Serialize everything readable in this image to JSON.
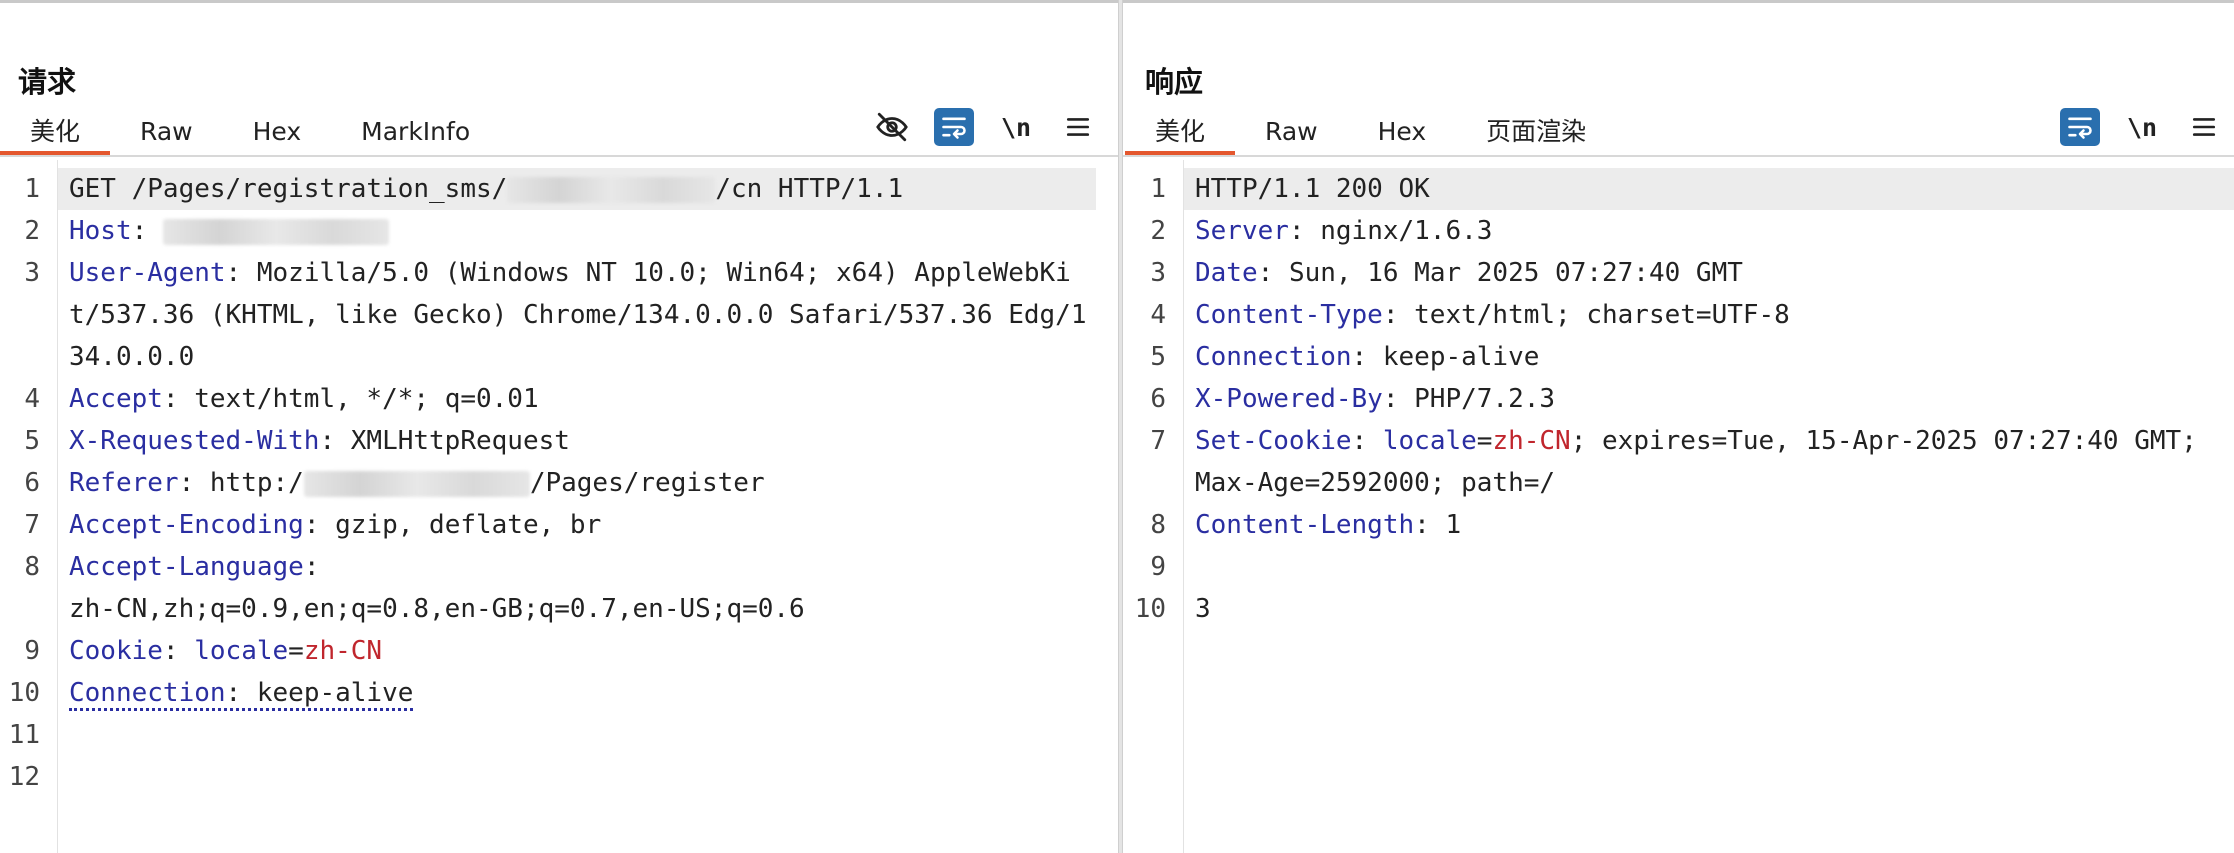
{
  "layout_switch": {
    "options": [
      {
        "icon": "split-horizontal-icon",
        "active": true
      },
      {
        "icon": "split-vertical-icon",
        "active": false
      },
      {
        "icon": "single-pane-icon",
        "active": false
      }
    ]
  },
  "request": {
    "title": "请求",
    "tabs": [
      {
        "label": "美化",
        "active": true
      },
      {
        "label": "Raw",
        "active": false
      },
      {
        "label": "Hex",
        "active": false
      },
      {
        "label": "MarkInfo",
        "active": false
      }
    ],
    "toolbar": {
      "hide_icon": "eye-off-icon",
      "wrap_icon": "wrap-lines-icon",
      "newline_label": "\\n",
      "menu_icon": "menu-icon"
    },
    "lines": {
      "l1_a": "GET /Pages/registration_sms/",
      "l1_b": "/cn HTTP/1.1",
      "l2_key": "Host",
      "l3_key": "User-Agent",
      "l3_val": "Mozilla/5.0 (Windows NT 10.0; Win64; x64) AppleWebKit/537.36 (KHTML, like Gecko) Chrome/134.0.0.0 Safari/537.36 Edg/134.0.0.0",
      "l4_key": "Accept",
      "l4_val": "text/html, */*; q=0.01",
      "l5_key": "X-Requested-With",
      "l5_val": "XMLHttpRequest",
      "l6_key": "Referer",
      "l6_val_a": "http:/",
      "l6_val_b": "/Pages/register",
      "l7_key": "Accept-Encoding",
      "l7_val": "gzip, deflate, br",
      "l8_key": "Accept-Language",
      "l8_val": "zh-CN,zh;q=0.9,en;q=0.8,en-GB;q=0.7,en-US;q=0.6",
      "l9_key": "Cookie",
      "l9_ckey": "locale",
      "l9_cval": "zh-CN",
      "l10_key": "Connection",
      "l10_val": "keep-alive"
    },
    "line_numbers": [
      "1",
      "2",
      "3",
      "4",
      "5",
      "6",
      "7",
      "8",
      "9",
      "10",
      "11",
      "12"
    ]
  },
  "response": {
    "title": "响应",
    "tabs": [
      {
        "label": "美化",
        "active": true
      },
      {
        "label": "Raw",
        "active": false
      },
      {
        "label": "Hex",
        "active": false
      },
      {
        "label": "页面渲染",
        "active": false
      }
    ],
    "toolbar": {
      "wrap_icon": "wrap-lines-icon",
      "newline_label": "\\n",
      "menu_icon": "menu-icon"
    },
    "lines": {
      "l1": "HTTP/1.1 200 OK",
      "l2_key": "Server",
      "l2_val": "nginx/1.6.3",
      "l3_key": "Date",
      "l3_val": "Sun, 16 Mar 2025 07:27:40 GMT",
      "l4_key": "Content-Type",
      "l4_val": "text/html; charset=UTF-8",
      "l5_key": "Connection",
      "l5_val": "keep-alive",
      "l6_key": "X-Powered-By",
      "l6_val": "PHP/7.2.3",
      "l7_key": "Set-Cookie",
      "l7_ckey": "locale",
      "l7_cval": "zh-CN",
      "l7_rest": "; expires=Tue, 15-Apr-2025 07:27:40 GMT; Max-Age=2592000; path=/",
      "l8_key": "Content-Length",
      "l8_val": "1",
      "l10": "3"
    },
    "line_numbers": [
      "1",
      "2",
      "3",
      "4",
      "5",
      "6",
      "7",
      "8",
      "9",
      "10"
    ]
  },
  "colors": {
    "accent_tab": "#e4572e",
    "active_button": "#2a6fae",
    "header_key": "#2a2ea1",
    "cookie_value": "#c0262d"
  }
}
